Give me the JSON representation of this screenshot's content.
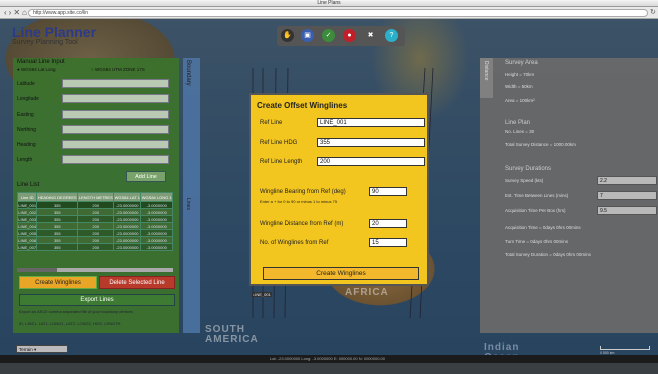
{
  "window": {
    "title": "Line Plans"
  },
  "browser": {
    "url": "http://www.app.site.co/lin"
  },
  "app": {
    "title": "Line Planner",
    "subtitle": "Survey Planning Tool"
  },
  "map_labels": {
    "africa": "AFRICA",
    "south_america": "SOUTH AMERICA",
    "indian_ocean": "Indian Ocean",
    "line_id": "LINE_001"
  },
  "left_panel": {
    "title": "Manual Line Input",
    "radio1": "WGS84 Lat Long",
    "radio2": "WGS84 UTM ZONE 17S",
    "fields": [
      {
        "label": "Latitude"
      },
      {
        "label": "Longitude"
      },
      {
        "label": "Easting"
      },
      {
        "label": "Northing"
      },
      {
        "label": "Heading"
      },
      {
        "label": "Length"
      }
    ],
    "add_button": "Add Line",
    "line_list_title": "Line List",
    "table_headers": [
      "Line ID",
      "HEADING DEGREES",
      "LENGTH METRES",
      "WGS84 LAT 1",
      "WGS84 LONG 1"
    ],
    "table_rows": [
      [
        "LINE_001",
        "355",
        "200",
        "-23.0000000",
        "-3.0000000"
      ],
      [
        "LINE_002",
        "355",
        "200",
        "-23.0000000",
        "-3.0000000"
      ],
      [
        "LINE_003",
        "355",
        "200",
        "-23.0000000",
        "-3.0000000"
      ],
      [
        "LINE_004",
        "355",
        "200",
        "-23.0000000",
        "-3.0000000"
      ],
      [
        "LINE_005",
        "355",
        "200",
        "-23.0000000",
        "-3.0000000"
      ],
      [
        "LINE_006",
        "355",
        "200",
        "-23.0000000",
        "-3.0000000"
      ],
      [
        "LINE_007",
        "355",
        "200",
        "-23.0000000",
        "-3.0000000"
      ]
    ],
    "create_winglines": "Create Winglines",
    "delete_line": "Delete Selected Line",
    "export_lines": "Export Lines",
    "export_note": "Export an ASCII comma separated file of your boundary vertices",
    "export_format": "ID, LINE1, LAT1, LONG1, LAT2, LONG2, HDG, LENGTH"
  },
  "boundary_tab": {
    "label": "Boundary",
    "lines": "Lines"
  },
  "right_panel": {
    "distance_tab": "Distance",
    "area_head": "Survey Area",
    "height": "Height = 70km",
    "width": "Width = 50km",
    "area": "Area = 100km²",
    "plan_head": "Line Plan",
    "num_lines": "No. Lines = 30",
    "total_dist": "Total Survey Distance = 1000.00km",
    "dur_head": "Survey Durations",
    "speed_label": "Survey Speed (kts)",
    "speed_val": "2.2",
    "turn_label": "Est. Time Between Lines (mins)",
    "turn_val": "7",
    "acq_label": "Acquisition Time Per Box (hrs)",
    "acq_val": "9.5",
    "acq_time": "Acquisition Time = 0days 0hrs 00mins",
    "turn_time": "Turn Time = 0days 0hrs 00mins",
    "total_duration": "Total Survey Duration = 0days 0hrs 00mins"
  },
  "modal": {
    "title": "Create Offset Winglines",
    "ref_line_label": "Ref Line",
    "ref_line_val": "LINE_001",
    "ref_hdg_label": "Ref Line HDG",
    "ref_hdg_val": "355",
    "ref_len_label": "Ref Line Length",
    "ref_len_val": "200",
    "bearing_label": "Wingline Bearing from Ref (deg)",
    "bearing_val": "90",
    "bearing_note": "Enter a + for 0 to 90 or minus 1 to minus 75",
    "distance_label": "Wingline Distance from Ref (m)",
    "distance_val": "20",
    "count_label": "No. of Winglines from Ref",
    "count_val": "15",
    "button": "Create Winglines"
  },
  "toolbar_icons": [
    "pan-icon",
    "select-icon",
    "draw-icon",
    "delete-icon",
    "close-icon",
    "help-icon"
  ],
  "toolbar_colors": [
    "#333333",
    "#3a5fb0",
    "#3c8c3c",
    "#c0202a",
    "#555555",
    "#2ab0c8"
  ],
  "toolbar_glyphs": [
    "✋",
    "▣",
    "✓",
    "●",
    "✖",
    "?"
  ],
  "status": {
    "coords": "Lat: -23.0000000 Long: -3.0000000    E: 000000.00 N: 0000000.00",
    "scale": "0  500 km"
  },
  "basemap": {
    "selected": "Terrain"
  }
}
